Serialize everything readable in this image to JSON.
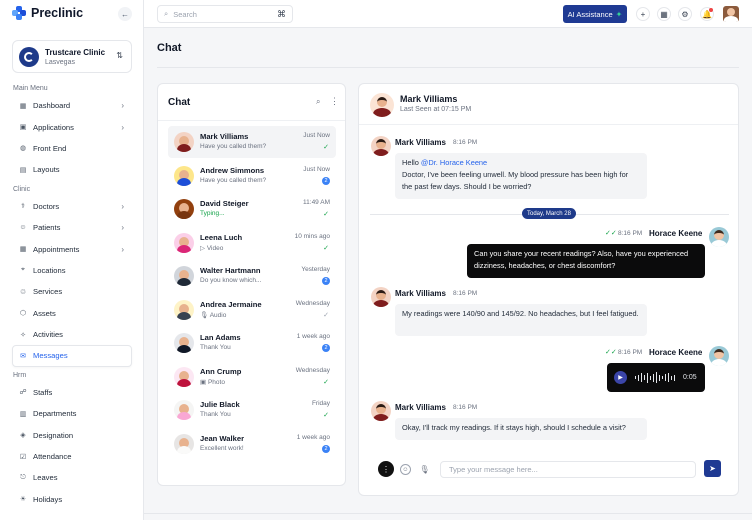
{
  "brand": {
    "name": "Preclinic",
    "color": "#2563eb"
  },
  "clinic": {
    "name": "Trustcare Clinic",
    "location": "Lasvegas"
  },
  "sidebar": {
    "groups": [
      {
        "title": "Main Menu",
        "items": [
          {
            "label": "Dashboard",
            "icon": "grid-icon",
            "has_children": true
          },
          {
            "label": "Applications",
            "icon": "apps-icon",
            "has_children": true
          },
          {
            "label": "Front End",
            "icon": "globe-icon",
            "has_children": false
          },
          {
            "label": "Layouts",
            "icon": "layout-icon",
            "has_children": false
          }
        ]
      },
      {
        "title": "Clinic",
        "items": [
          {
            "label": "Doctors",
            "icon": "doctor-icon",
            "has_children": true
          },
          {
            "label": "Patients",
            "icon": "patient-icon",
            "has_children": true
          },
          {
            "label": "Appointments",
            "icon": "calendar-icon",
            "has_children": true
          },
          {
            "label": "Locations",
            "icon": "map-pin-icon",
            "has_children": false
          },
          {
            "label": "Services",
            "icon": "services-icon",
            "has_children": false
          },
          {
            "label": "Assets",
            "icon": "assets-icon",
            "has_children": false
          },
          {
            "label": "Activities",
            "icon": "activity-icon",
            "has_children": false
          },
          {
            "label": "Messages",
            "icon": "message-icon",
            "has_children": false,
            "active": true
          }
        ]
      },
      {
        "title": "Hrm",
        "items": [
          {
            "label": "Staffs",
            "icon": "staff-icon",
            "has_children": false
          },
          {
            "label": "Departments",
            "icon": "building-icon",
            "has_children": false
          },
          {
            "label": "Designation",
            "icon": "badge-icon",
            "has_children": false
          },
          {
            "label": "Attendance",
            "icon": "attendance-icon",
            "has_children": false
          },
          {
            "label": "Leaves",
            "icon": "leave-icon",
            "has_children": false
          },
          {
            "label": "Holidays",
            "icon": "holiday-icon",
            "has_children": false
          }
        ]
      }
    ]
  },
  "topbar": {
    "search_placeholder": "Search",
    "shortcut": "⌘",
    "ai_button": "AI Assistance"
  },
  "page": {
    "title": "Chat"
  },
  "chat_list": {
    "title": "Chat",
    "conversations": [
      {
        "name": "Mark Villiams",
        "message": "Have you called them?",
        "time": "Just Now",
        "status": "read",
        "selected": true,
        "avatar_bg": "#f3d3c4",
        "shirt": "#7f1d1d"
      },
      {
        "name": "Andrew Simmons",
        "message": "Have you called them?",
        "time": "Just Now",
        "status": "badge",
        "badge": "2",
        "avatar_bg": "#fde68a",
        "shirt": "#1d4ed8"
      },
      {
        "name": "David Steiger",
        "message": "Typing...",
        "time": "11:49 AM",
        "status": "read",
        "typing": true,
        "avatar_bg": "#92400e",
        "shirt": "#78350f"
      },
      {
        "name": "Leena Luch",
        "message": "Video",
        "time": "10 mins ago",
        "status": "read",
        "avatar_bg": "#fbcfe8",
        "shirt": "#db2777"
      },
      {
        "name": "Walter Hartmann",
        "message": "Do you know which...",
        "time": "Yesterday",
        "status": "badge",
        "badge": "2",
        "avatar_bg": "#d1d5db",
        "shirt": "#1f2937"
      },
      {
        "name": "Andrea Jermaine",
        "message": "Audio",
        "time": "Wednesday",
        "status": "sent",
        "avatar_bg": "#fef3c7",
        "shirt": "#374151"
      },
      {
        "name": "Lan Adams",
        "message": "Thank You",
        "time": "1 week ago",
        "status": "badge",
        "badge": "2",
        "avatar_bg": "#e5e7eb",
        "shirt": "#111827"
      },
      {
        "name": "Ann Crump",
        "message": "Photo",
        "time": "Wednesday",
        "status": "read",
        "avatar_bg": "#fce7f3",
        "shirt": "#be123c"
      },
      {
        "name": "Julie Black",
        "message": "Thank You",
        "time": "Friday",
        "status": "read",
        "avatar_bg": "#f5f5f4",
        "shirt": "#f9a8d4"
      },
      {
        "name": "Jean Walker",
        "message": "Excellent work!",
        "time": "1 week ago",
        "status": "badge",
        "badge": "2",
        "avatar_bg": "#e7e5e4",
        "shirt": "#fafaf9"
      }
    ]
  },
  "chat": {
    "contact_name": "Mark Villiams",
    "last_seen": "Last Seen at 07:15 PM",
    "date_divider": "Today, March 28",
    "messages": [
      {
        "from": "Mark Villiams",
        "time": "8:16 PM",
        "mention": "@Dr. Horace Keene",
        "greeting": "Hello",
        "text": "Doctor, I've been feeling unwell. My blood pressure has been high for the past few days. Should I be worried?"
      },
      {
        "from": "Horace Keene",
        "time": "8:16 PM",
        "text": "Can you share your recent readings? Also, have you experienced dizziness, headaches, or chest discomfort?"
      },
      {
        "from": "Mark Villiams",
        "time": "8:16 PM",
        "text": "My readings were 140/90 and 145/92. No headaches, but I feel fatigued."
      },
      {
        "from": "Horace Keene",
        "time": "8:16 PM",
        "audio_duration": "0:05"
      },
      {
        "from": "Mark Villiams",
        "time": "8:16 PM",
        "text": "Okay, I'll track my readings. If it stays high, should I schedule a visit?"
      }
    ],
    "compose_placeholder": "Type your message here..."
  }
}
